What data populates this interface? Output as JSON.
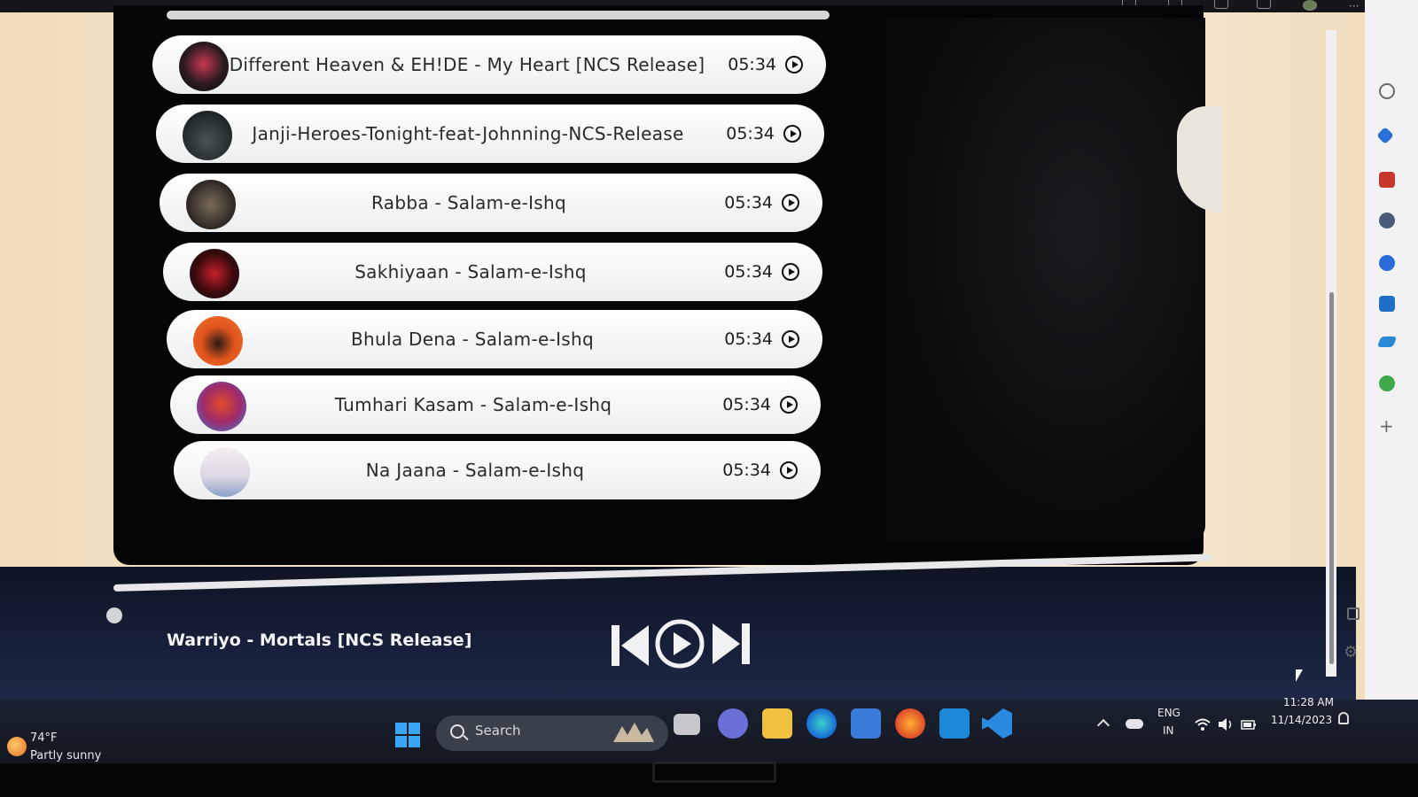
{
  "playlist": {
    "songs": [
      {
        "title": "Different Heaven & EH!DE - My Heart [NCS Release]",
        "duration": "05:34"
      },
      {
        "title": "Janji-Heroes-Tonight-feat-Johnning-NCS-Release",
        "duration": "05:34"
      },
      {
        "title": "Rabba - Salam-e-Ishq",
        "duration": "05:34"
      },
      {
        "title": "Sakhiyaan - Salam-e-Ishq",
        "duration": "05:34"
      },
      {
        "title": "Bhula Dena - Salam-e-Ishq",
        "duration": "05:34"
      },
      {
        "title": "Tumhari Kasam - Salam-e-Ishq",
        "duration": "05:34"
      },
      {
        "title": "Na Jaana - Salam-e-Ishq",
        "duration": "05:34"
      }
    ]
  },
  "player": {
    "now_playing": "Warriyo - Mortals [NCS Release]",
    "progress": 0.0,
    "controls": [
      "previous-icon",
      "play-icon",
      "next-icon"
    ]
  },
  "taskbar": {
    "weather_temp": "74°F",
    "weather_desc": "Partly sunny",
    "search_label": "Search",
    "lang_line1": "ENG",
    "lang_line2": "IN",
    "time": "11:28 AM",
    "date": "11/14/2023"
  },
  "colors": {
    "row_bg": "#ffffff",
    "player_bg": "#17203a",
    "panel_bg": "#050508",
    "accent": "#3ba6f5"
  }
}
